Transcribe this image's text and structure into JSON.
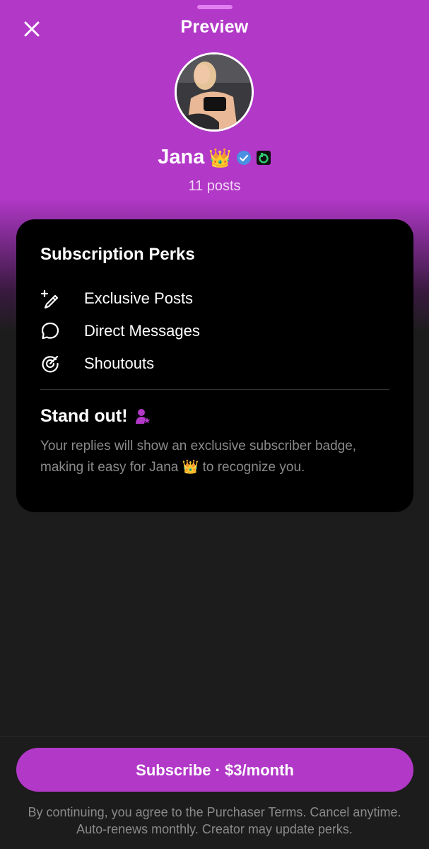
{
  "header": {
    "title": "Preview"
  },
  "profile": {
    "name": "Jana",
    "name_emoji": "👑",
    "posts_text": "11 posts",
    "verified_color": "#4a90e2"
  },
  "perks": {
    "title": "Subscription Perks",
    "items": [
      {
        "label": "Exclusive Posts",
        "icon": "pencil-sparkle-icon"
      },
      {
        "label": "Direct Messages",
        "icon": "chat-bubble-icon"
      },
      {
        "label": "Shoutouts",
        "icon": "target-icon"
      }
    ]
  },
  "standout": {
    "title": "Stand out!",
    "icon": "subscriber-badge-icon",
    "description": "Your replies will show an exclusive subscriber badge, making it easy for Jana 👑 to recognize you."
  },
  "footer": {
    "subscribe_label": "Subscribe · $3/month",
    "legal_text": "By continuing, you agree to the Purchaser Terms. Cancel anytime. Auto-renews monthly. Creator may update perks."
  },
  "colors": {
    "accent": "#b238c8",
    "card_bg": "#000000",
    "page_bg": "#1c1c1c"
  }
}
